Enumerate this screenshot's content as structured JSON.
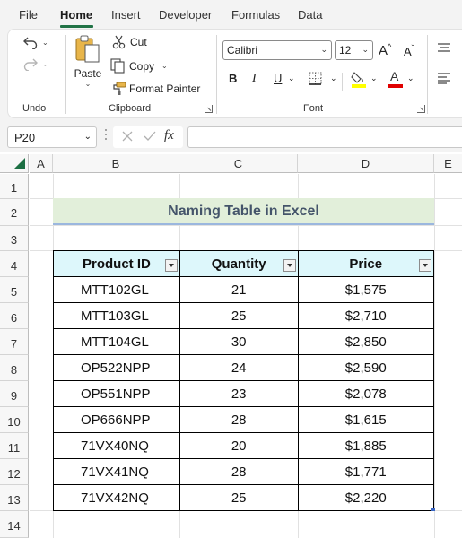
{
  "menu": {
    "tabs": [
      "File",
      "Home",
      "Insert",
      "Developer",
      "Formulas",
      "Data"
    ]
  },
  "ribbon": {
    "undo_group": "Undo",
    "clipboard": {
      "paste": "Paste",
      "cut": "Cut",
      "copy": "Copy",
      "format_painter": "Format Painter",
      "group_label": "Clipboard"
    },
    "font": {
      "name": "Calibri",
      "size": "12",
      "bold": "B",
      "italic": "I",
      "underline": "U",
      "group_label": "Font"
    }
  },
  "formula_bar": {
    "name_box": "P20",
    "fx": "fx",
    "content": ""
  },
  "sheet": {
    "columns": [
      "A",
      "B",
      "C",
      "D",
      "E"
    ],
    "rows": [
      "1",
      "2",
      "3",
      "4",
      "5",
      "6",
      "7",
      "8",
      "9",
      "10",
      "11",
      "12",
      "13",
      "14"
    ],
    "title": "Naming Table in Excel",
    "table": {
      "headers": [
        "Product ID",
        "Quantity",
        "Price"
      ],
      "rows": [
        [
          "MTT102GL",
          "21",
          "$1,575"
        ],
        [
          "MTT103GL",
          "25",
          "$2,710"
        ],
        [
          "MTT104GL",
          "30",
          "$2,850"
        ],
        [
          "OP522NPP",
          "24",
          "$2,590"
        ],
        [
          "OP551NPP",
          "23",
          "$2,078"
        ],
        [
          "OP666NPP",
          "28",
          "$1,615"
        ],
        [
          "71VX40NQ",
          "20",
          "$1,885"
        ],
        [
          "71VX41NQ",
          "28",
          "$1,771"
        ],
        [
          "71VX42NQ",
          "25",
          "$2,220"
        ]
      ]
    }
  },
  "colors": {
    "accent": "#217346",
    "title_fill": "#e2efda",
    "title_text": "#44546a",
    "header_fill": "#ddf7fb",
    "highlight_yellow": "#ffff00",
    "font_red": "#e00000"
  }
}
